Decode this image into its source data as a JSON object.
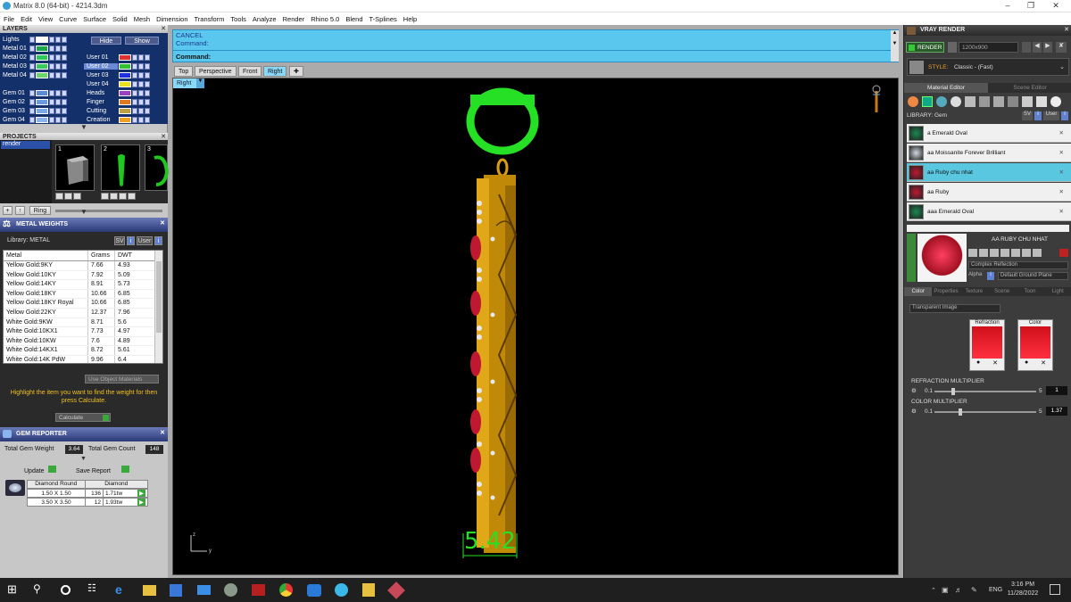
{
  "window": {
    "title": "Matrix 8.0 (64-bit) - 4214.3dm"
  },
  "menu": [
    "File",
    "Edit",
    "View",
    "Curve",
    "Surface",
    "Solid",
    "Mesh",
    "Dimension",
    "Transform",
    "Tools",
    "Analyze",
    "Render",
    "Rhino 5.0",
    "Blend",
    "T-Splines",
    "Help"
  ],
  "layers": {
    "title": "LAYERS",
    "hide": "Hide",
    "show": "Show",
    "left": [
      {
        "name": "Lights",
        "color": "#ffffff"
      },
      {
        "name": "Metal 01",
        "color": "#1aa84a"
      },
      {
        "name": "Metal 02",
        "color": "#2ec85a"
      },
      {
        "name": "Metal 03",
        "color": "#38c860"
      },
      {
        "name": "Metal 04",
        "color": "#6ad66a"
      },
      {
        "name": "Gem 01",
        "color": "#5a8ad8"
      },
      {
        "name": "Gem 02",
        "color": "#6a9ae0"
      },
      {
        "name": "Gem 03",
        "color": "#7aa8e8"
      },
      {
        "name": "Gem 04",
        "color": "#8ab4f0"
      }
    ],
    "right": [
      {
        "name": "User 01",
        "color": "#e03030"
      },
      {
        "name": "User 02",
        "color": "#30c030"
      },
      {
        "name": "User 03",
        "color": "#2030e0"
      },
      {
        "name": "User 04",
        "color": "#e8e020"
      },
      {
        "name": "Heads",
        "color": "#9a40c0"
      },
      {
        "name": "Finger",
        "color": "#e07820"
      },
      {
        "name": "Cutting",
        "color": "#c0a040"
      },
      {
        "name": "Creation",
        "color": "#f0a020"
      }
    ]
  },
  "projects": {
    "title": "PROJECTS",
    "item": "render",
    "thumbs": [
      "1",
      "2",
      "3"
    ],
    "ring_btn": "Ring"
  },
  "metal_weights": {
    "title": "METAL WEIGHTS",
    "library": "Library: METAL",
    "sv": "SV",
    "user": "User",
    "headers": [
      "Metal",
      "Grams",
      "DWT"
    ],
    "rows": [
      [
        "Yellow Gold:9KY",
        "7.66",
        "4.93"
      ],
      [
        "Yellow Gold:10KY",
        "7.92",
        "5.09"
      ],
      [
        "Yellow Gold:14KY",
        "8.91",
        "5.73"
      ],
      [
        "Yellow Gold:18KY",
        "10.66",
        "6.85"
      ],
      [
        "Yellow Gold:18KY Royal",
        "10.66",
        "6.85"
      ],
      [
        "Yellow Gold:22KY",
        "12.37",
        "7.96"
      ],
      [
        "White Gold:9KW",
        "8.71",
        "5.6"
      ],
      [
        "White Gold:10KX1",
        "7.73",
        "4.97"
      ],
      [
        "White Gold:10KW",
        "7.6",
        "4.89"
      ],
      [
        "White Gold:14KX1",
        "8.72",
        "5.61"
      ],
      [
        "White Gold:14K PdW",
        "9.96",
        "6.4"
      ]
    ],
    "use_object": "Use Object Materials",
    "hint": "Highlight the item you want to find the weight for then press Calculate.",
    "calculate": "Calculate"
  },
  "gem_reporter": {
    "title": "GEM REPORTER",
    "total_weight_label": "Total Gem Weight",
    "total_weight": "3.64",
    "total_count_label": "Total Gem Count",
    "total_count": "148",
    "update": "Update",
    "save": "Save Report",
    "headers": [
      "Diamond Round",
      "Diamond"
    ],
    "rows": [
      [
        "1.50 X 1.50",
        "136",
        "1.71tw"
      ],
      [
        "3.50 X 3.50",
        "12",
        "1.93tw"
      ]
    ]
  },
  "command": {
    "line1": "CANCEL",
    "line2": "Command:",
    "prompt": "Command:"
  },
  "view_tabs": [
    "Top",
    "Perspective",
    "Front",
    "Right"
  ],
  "viewport": {
    "label": "Right",
    "dimension": "5.42",
    "axis_z": "z",
    "axis_y": "y"
  },
  "vray": {
    "title": "VRAY RENDER",
    "render": "RENDER",
    "resolution": "1200x900",
    "style_label": "STYLE:",
    "style": "Classic - (Fast)",
    "tabs": [
      "Material Editor",
      "Scene Editor"
    ],
    "library": "LIBRARY: Gem",
    "sv": "SV",
    "user": "User",
    "materials": [
      {
        "name": "a Emerald Oval",
        "color": "#1a8a50"
      },
      {
        "name": "aa Moissanite Forever Brilliant",
        "color": "#cfd8e0"
      },
      {
        "name": "aa Ruby chu nhat",
        "color": "#c01830"
      },
      {
        "name": "aa Ruby",
        "color": "#c01830"
      },
      {
        "name": "aaa Emerald Oval",
        "color": "#1a8a50"
      }
    ],
    "selected_name": "AA RUBY CHU NHAT",
    "complex": "Complex Reflection",
    "alpha": "Alpha",
    "ground": "Default Ground Plane",
    "subtabs": [
      "Color",
      "Properties",
      "Texture",
      "Scene",
      "Toon",
      "Light"
    ],
    "transparent": "Transparent Image",
    "refraction": "Refraction",
    "color": "Color",
    "refraction_mult": "REFRACTION MULTIPLIER",
    "refraction_min": "0.1",
    "refraction_max": "5",
    "refraction_val": "1",
    "color_mult": "COLOR MULTIPLIER",
    "color_min": "0.1",
    "color_max": "5",
    "color_val": "1.37"
  },
  "taskbar": {
    "lang": "ENG",
    "time": "3:16 PM",
    "date": "11/28/2022"
  }
}
